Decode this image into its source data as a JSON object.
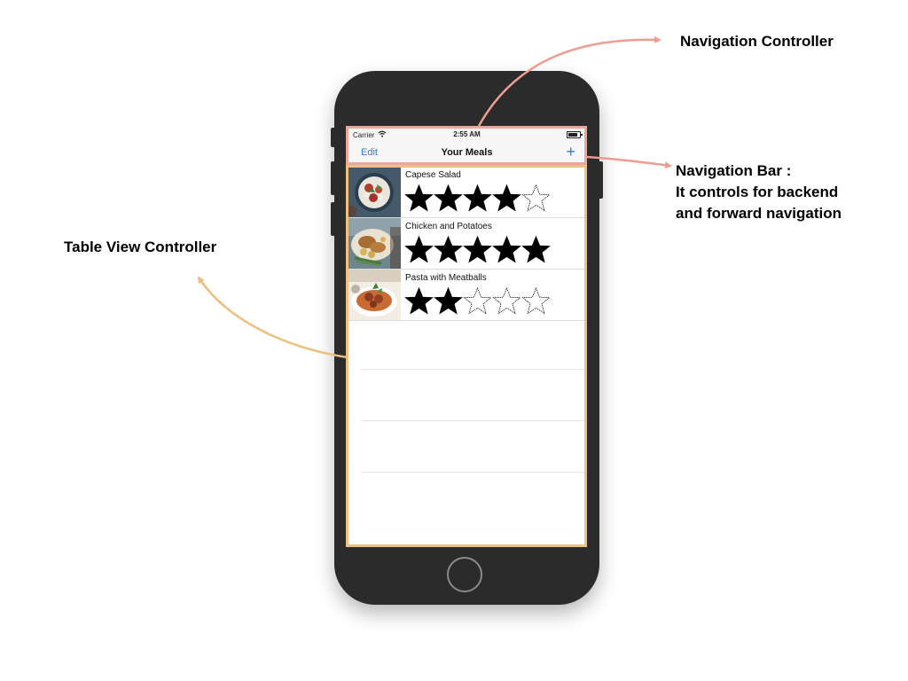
{
  "annotations": {
    "navigation_controller": "Navigation Controller",
    "navigation_bar_line1": "Navigation Bar :",
    "navigation_bar_line2": "It controls for backend",
    "navigation_bar_line3": "and forward navigation",
    "table_view_controller": "Table View Controller"
  },
  "status_bar": {
    "carrier": "Carrier",
    "time": "2:55 AM"
  },
  "nav": {
    "edit_label": "Edit",
    "title": "Your Meals",
    "add_label": "+"
  },
  "meals": [
    {
      "name": "Capese Salad",
      "rating": 4,
      "max_rating": 5
    },
    {
      "name": "Chicken and Potatoes",
      "rating": 5,
      "max_rating": 5
    },
    {
      "name": "Pasta with Meatballs",
      "rating": 2,
      "max_rating": 5
    }
  ],
  "colors": {
    "nav_controller_arrow": "#ee9d90",
    "table_controller_arrow": "#eebf7e",
    "tint": "#2f7bd6",
    "phone_body": "#2b2b2b"
  },
  "icons": {
    "wifi": "wifi-icon",
    "battery": "battery-icon",
    "add": "plus-icon",
    "filled_star": "filled-star-icon",
    "empty_star": "empty-star-icon"
  }
}
